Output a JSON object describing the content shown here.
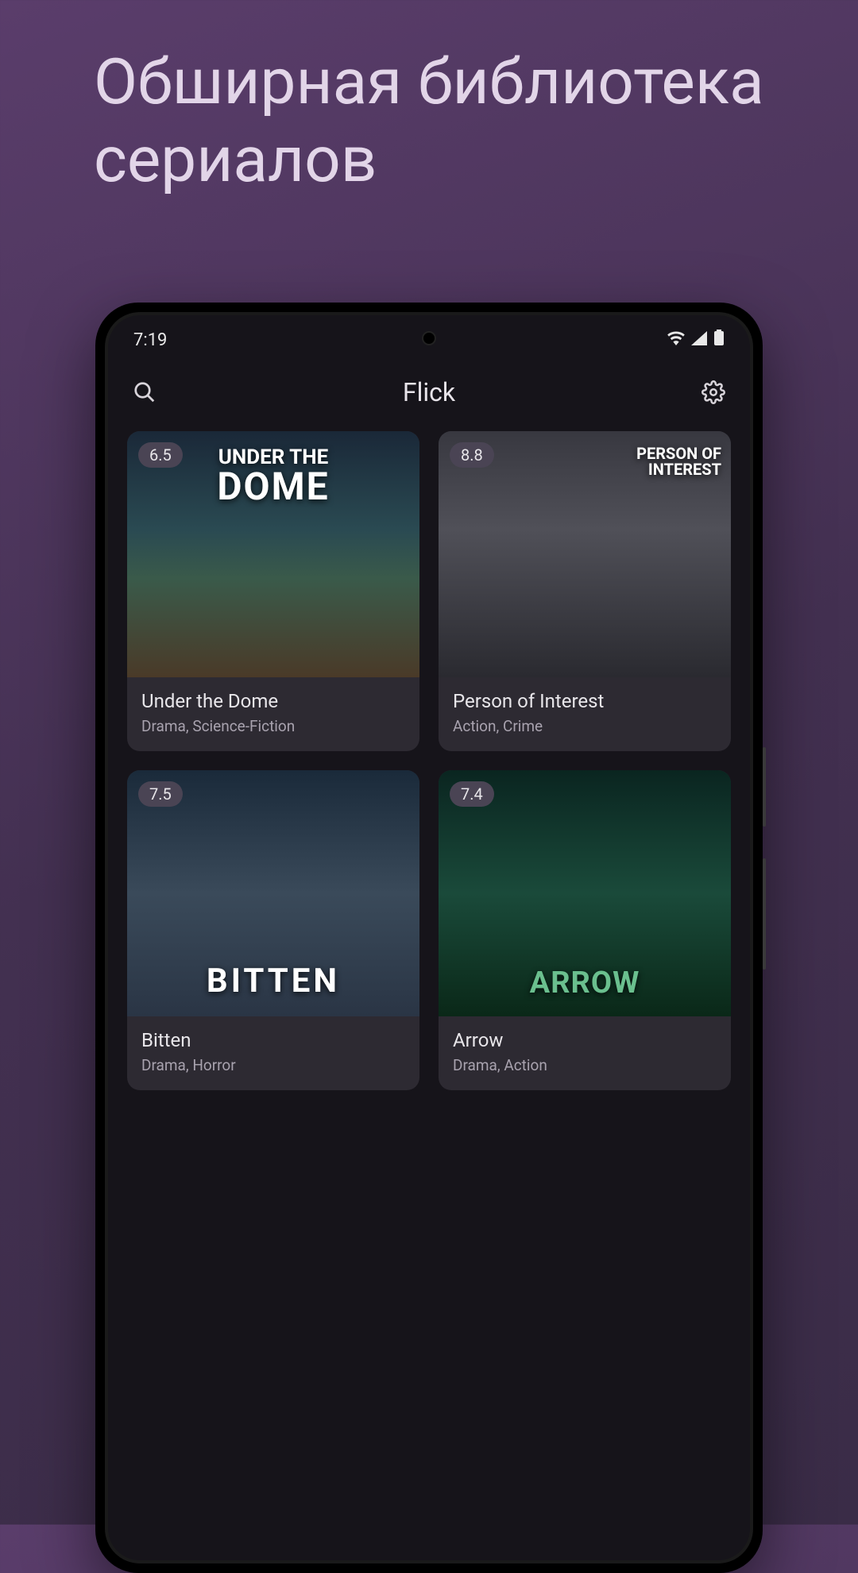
{
  "headline": "Обширная библиотека сериалов",
  "status": {
    "time": "7:19"
  },
  "header": {
    "title": "Flick"
  },
  "items": [
    {
      "rating": "6.5",
      "title": "Under the Dome",
      "genres": "Drama, Science-Fiction",
      "poster_text_small": "UNDER THE",
      "poster_text_big": "DOME"
    },
    {
      "rating": "8.8",
      "title": "Person of Interest",
      "genres": "Action, Crime",
      "poster_text_small": "PERSON OF",
      "poster_text_big": "INTEREST"
    },
    {
      "rating": "7.5",
      "title": "Bitten",
      "genres": "Drama, Horror",
      "poster_text_big": "BITTEN"
    },
    {
      "rating": "7.4",
      "title": "Arrow",
      "genres": "Drama, Action",
      "poster_text_big": "ARROW"
    }
  ]
}
